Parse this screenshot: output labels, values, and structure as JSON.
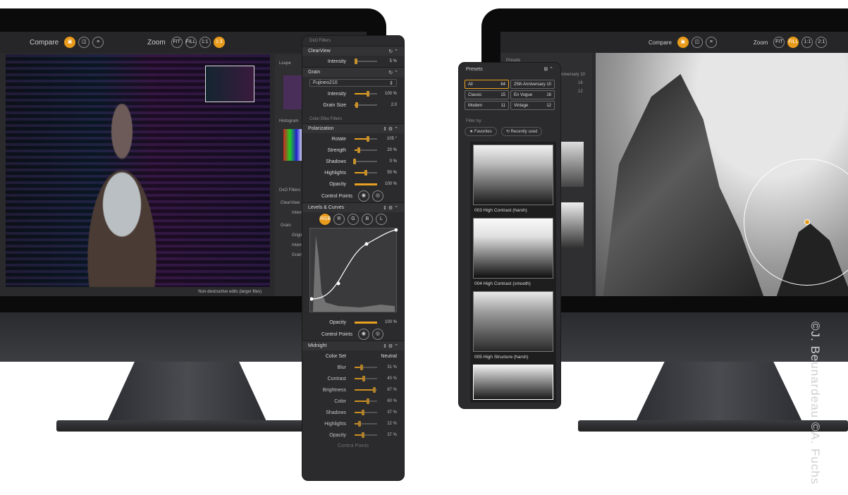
{
  "left_app": {
    "compare_label": "Compare",
    "zoom_label": "Zoom",
    "zoom_buttons": [
      "FIT",
      "FILL",
      "1:1",
      "1:3"
    ],
    "status_text": "Non-destructive edits (larger files)",
    "side_panel": {
      "loupe": "Loupe",
      "histogram": "Histogram",
      "dxo_filters": "DxO Filters",
      "items": [
        "ClearView",
        "Intensity",
        "Grain",
        "Original",
        "Intensity",
        "Grain Size"
      ]
    }
  },
  "filters_panel": {
    "header": "DxO Filters",
    "clearview": {
      "title": "ClearView",
      "intensity_label": "Intensity",
      "intensity_value": "5 %",
      "intensity_level": 0.05
    },
    "grain": {
      "title": "Grain",
      "film": "Fujineo210",
      "intensity_label": "Intensity",
      "intensity_value": "100 %",
      "intensity_level": 0.6,
      "size_label": "Grain Size",
      "size_value": "2.0",
      "size_level": 0.1
    },
    "group_label": "Color Efex Filters",
    "polarization": {
      "title": "Polarization",
      "rows": [
        {
          "label": "Rotate",
          "value": "105 °",
          "level": 0.6
        },
        {
          "label": "Strength",
          "value": "20 %",
          "level": 0.2
        },
        {
          "label": "Shadows",
          "value": "0 %",
          "level": 0.0
        },
        {
          "label": "Highlights",
          "value": "50 %",
          "level": 0.5
        }
      ],
      "opacity_label": "Opacity",
      "opacity_value": "100 %",
      "opacity_level": 1.0,
      "control_points_label": "Control Points"
    },
    "levels": {
      "title": "Levels & Curves",
      "channels": [
        "RGB",
        "R",
        "G",
        "B",
        "L"
      ],
      "opacity_label": "Opacity",
      "opacity_value": "100 %",
      "opacity_level": 1.0,
      "control_points_label": "Control Points"
    },
    "midnight": {
      "title": "Midnight",
      "color_set_label": "Color Set",
      "color_set_value": "Neutral",
      "rows": [
        {
          "label": "Blur",
          "value": "31 %",
          "level": 0.31
        },
        {
          "label": "Contrast",
          "value": "40 %",
          "level": 0.4
        },
        {
          "label": "Brightness",
          "value": "87 %",
          "level": 0.87
        },
        {
          "label": "Color",
          "value": "60 %",
          "level": 0.6
        },
        {
          "label": "Shadows",
          "value": "37 %",
          "level": 0.37
        },
        {
          "label": "Highlights",
          "value": "22 %",
          "level": 0.22
        },
        {
          "label": "Opacity",
          "value": "37 %",
          "level": 0.37
        }
      ],
      "control_points_label": "Control Points"
    }
  },
  "presets_panel": {
    "title": "Presets",
    "categories": [
      {
        "name": "All",
        "count": "64"
      },
      {
        "name": "25th Anniversary",
        "count": "10"
      },
      {
        "name": "Classic",
        "count": "15"
      },
      {
        "name": "En Vogue",
        "count": "16"
      },
      {
        "name": "Modern",
        "count": "11"
      },
      {
        "name": "Vintage",
        "count": "12"
      }
    ],
    "filter_by_label": "Filter by:",
    "favorites_label": "Favorites",
    "recent_label": "Recently used",
    "items": [
      "003 High Contrast (harsh)",
      "004 High Contrast (smooth)",
      "005 High Structure (harsh)"
    ]
  },
  "right_app": {
    "compare_label": "Compare",
    "zoom_label": "Zoom",
    "zoom_buttons": [
      "FIT",
      "FILL",
      "1:1",
      "2:1"
    ],
    "side_panel": {
      "presets": "Presets",
      "tags": [
        "Anniversary 10",
        "16",
        "12"
      ]
    }
  },
  "credit": "©J. Beunardeau ©A. Fuchs",
  "colors": {
    "accent": "#e89a1a",
    "panel": "#2b2b2d"
  }
}
